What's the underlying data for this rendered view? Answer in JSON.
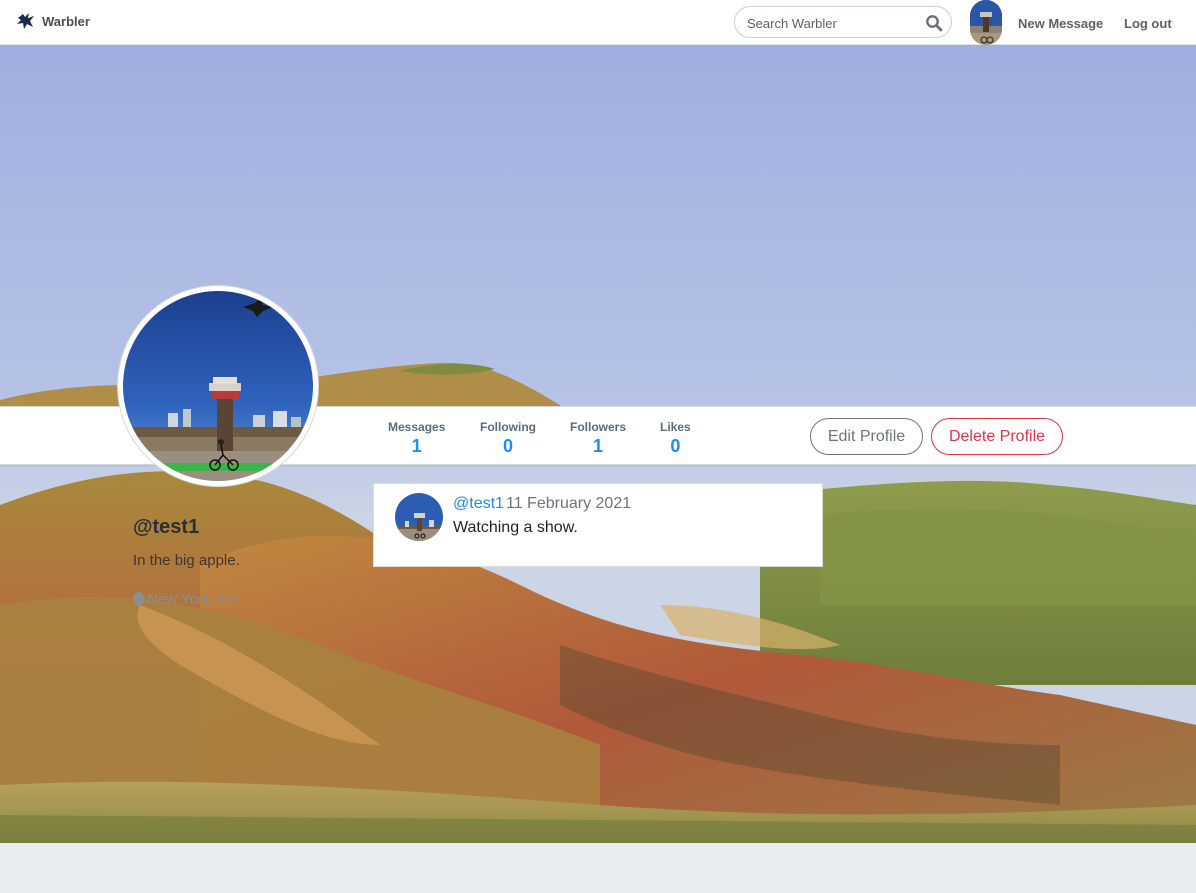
{
  "navbar": {
    "brand": "Warbler",
    "search_placeholder": "Search Warbler",
    "new_message": "New Message",
    "logout": "Log out"
  },
  "profile": {
    "username": "@test1",
    "bio": "In the big apple.",
    "location": "New York, NY"
  },
  "stats": [
    {
      "label": "Messages",
      "value": "1"
    },
    {
      "label": "Following",
      "value": "0"
    },
    {
      "label": "Followers",
      "value": "1"
    },
    {
      "label": "Likes",
      "value": "0"
    }
  ],
  "actions": {
    "edit": "Edit Profile",
    "delete": "Delete Profile"
  },
  "messages": [
    {
      "user": "@test1",
      "date": "11 February 2021",
      "text": "Watching a show."
    }
  ],
  "colors": {
    "accent": "#1a8cff",
    "danger": "#dc3545",
    "secondary": "#6c757d"
  }
}
